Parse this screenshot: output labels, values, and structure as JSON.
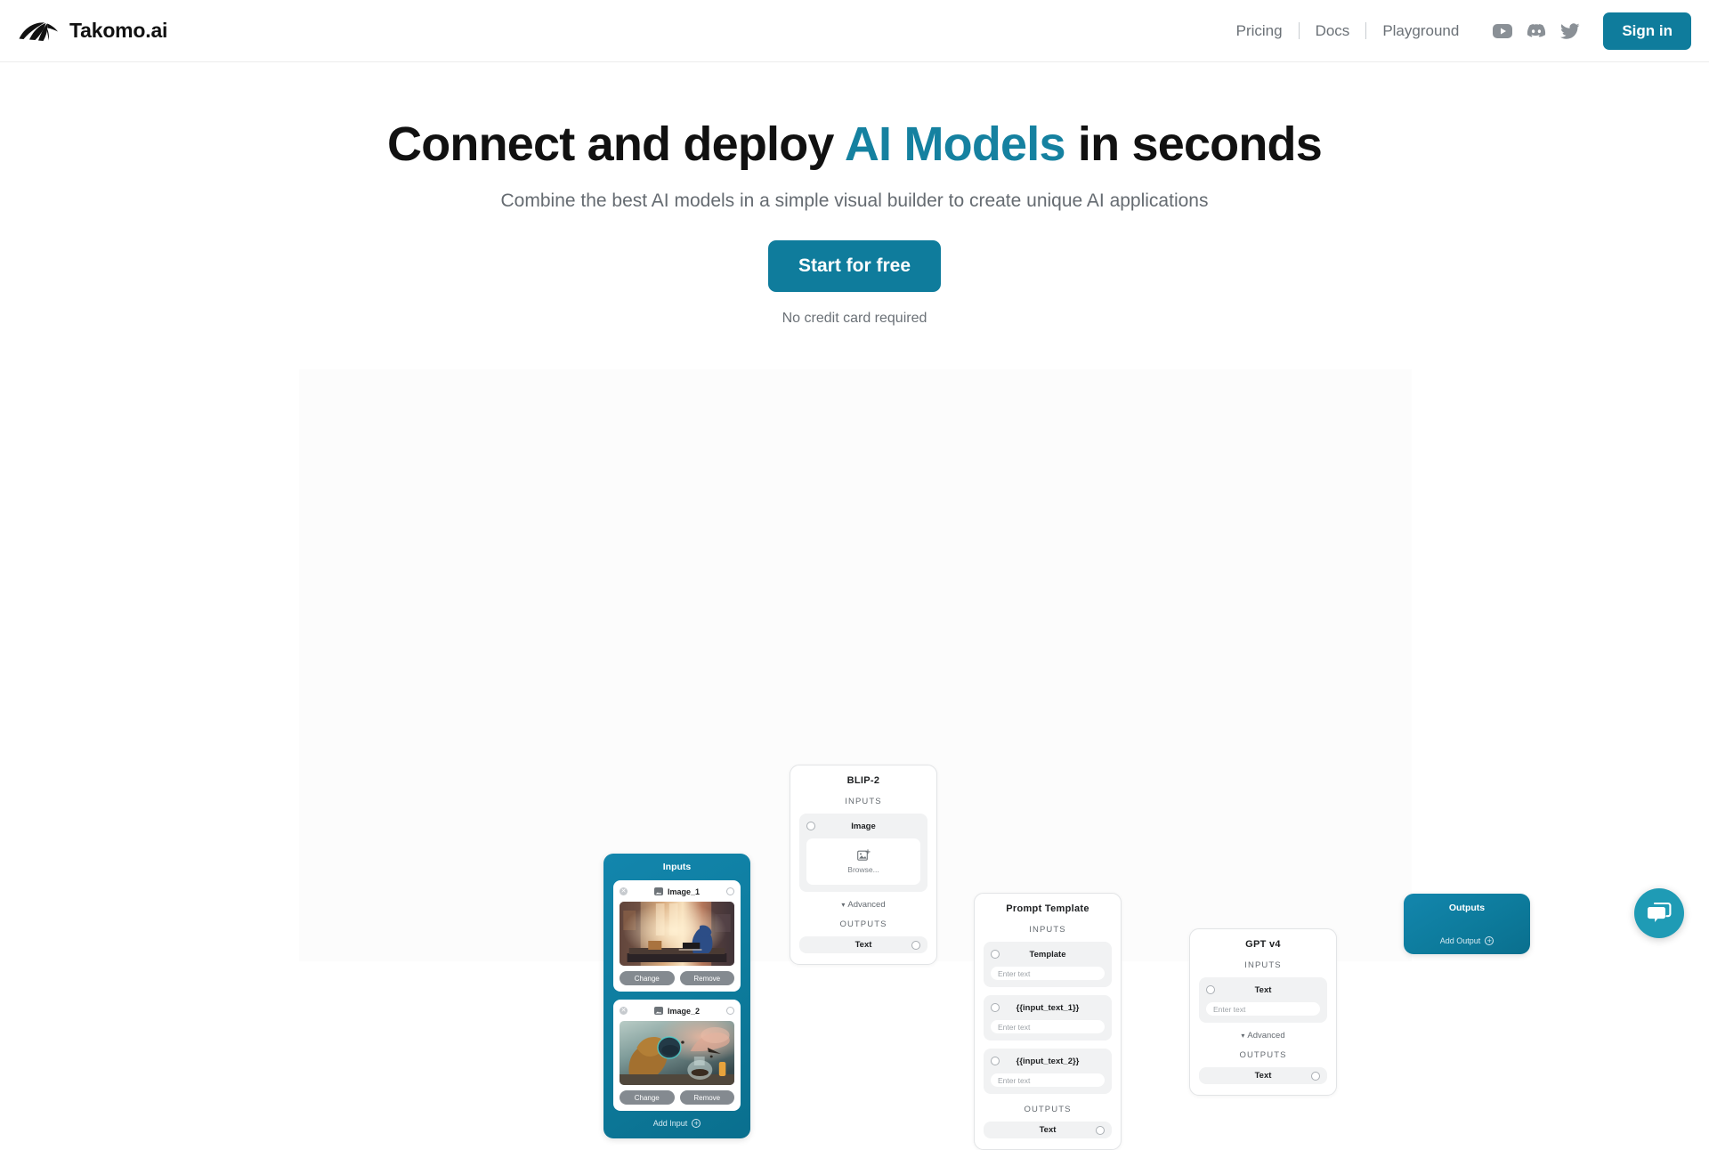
{
  "brand": {
    "name": "Takomo.ai",
    "logo_icon": "takomo-wing-logo"
  },
  "nav": {
    "links": [
      {
        "label": "Pricing"
      },
      {
        "label": "Docs"
      },
      {
        "label": "Playground"
      }
    ],
    "social": [
      {
        "name": "youtube-icon"
      },
      {
        "name": "discord-icon"
      },
      {
        "name": "twitter-icon"
      }
    ],
    "signin_label": "Sign in"
  },
  "hero": {
    "title_part1": "Connect and deploy ",
    "title_accent": "AI Models",
    "title_part2": " in seconds",
    "subtitle": "Combine the best AI models in a simple visual builder to create unique AI applications",
    "cta_label": "Start for free",
    "cta_note": "No credit card required"
  },
  "colors": {
    "accent": "#0f7c9c",
    "accent_text": "#1581a0",
    "panel_blue": "#0d7b9c",
    "chat_teal": "#1f9bb5",
    "node_border": "#e2e4e6",
    "port_bg": "#f1f2f3"
  },
  "builder": {
    "inputs_panel": {
      "title": "Inputs",
      "add_label": "Add Input",
      "add_icon": "plus-circle-icon",
      "cards": [
        {
          "name": "Image_1",
          "type_icon": "image-icon",
          "remove_icon": "close-circle-icon",
          "port_icon": "output-port",
          "change_label": "Change",
          "remove_label": "Remove",
          "thumbnail_alt": "Blue figure seated at a low desk in a warm sunlit corridor"
        },
        {
          "name": "Image_2",
          "type_icon": "image-icon",
          "remove_icon": "close-circle-icon",
          "port_icon": "output-port",
          "change_label": "Change",
          "remove_label": "Remove",
          "thumbnail_alt": "Scientist in goggles leaning over a smoking flask"
        }
      ]
    },
    "nodes": [
      {
        "id": "blip",
        "title": "BLIP-2",
        "inputs_label": "INPUTS",
        "outputs_label": "OUTPUTS",
        "advanced_label": "Advanced",
        "has_advanced": true,
        "inputs": [
          {
            "name": "Image",
            "widget": "dropzone",
            "dropzone_label": "Browse...",
            "dropzone_icon": "image-add-icon"
          }
        ],
        "outputs": [
          {
            "name": "Text"
          }
        ]
      },
      {
        "id": "prompt",
        "title": "Prompt Template",
        "inputs_label": "INPUTS",
        "outputs_label": "OUTPUTS",
        "has_advanced": false,
        "inputs": [
          {
            "name": "Template",
            "widget": "text",
            "placeholder": "Enter text"
          },
          {
            "name": "{{input_text_1}}",
            "widget": "text",
            "placeholder": "Enter text"
          },
          {
            "name": "{{input_text_2}}",
            "widget": "text",
            "placeholder": "Enter text"
          }
        ],
        "outputs": [
          {
            "name": "Text"
          }
        ]
      },
      {
        "id": "gpt",
        "title": "GPT v4",
        "inputs_label": "INPUTS",
        "outputs_label": "OUTPUTS",
        "advanced_label": "Advanced",
        "has_advanced": true,
        "inputs": [
          {
            "name": "Text",
            "widget": "text",
            "placeholder": "Enter text"
          }
        ],
        "outputs": [
          {
            "name": "Text"
          }
        ]
      }
    ],
    "outputs_panel": {
      "title": "Outputs",
      "add_label": "Add Output",
      "add_icon": "plus-circle-icon"
    }
  },
  "chat": {
    "icon": "chat-bubbles-icon"
  }
}
